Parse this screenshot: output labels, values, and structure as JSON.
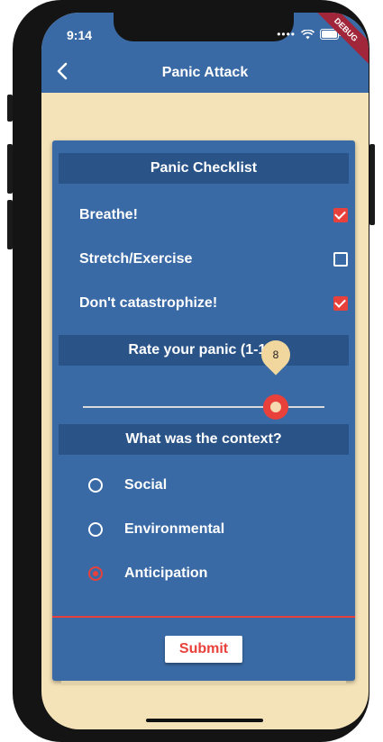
{
  "status_bar": {
    "time": "9:14",
    "debug_label": "DEBUG"
  },
  "app_bar": {
    "title": "Panic Attack"
  },
  "checklist": {
    "header": "Panic Checklist",
    "items": [
      {
        "label": "Breathe!",
        "checked": true
      },
      {
        "label": "Stretch/Exercise",
        "checked": false
      },
      {
        "label": "Don't catastrophize!",
        "checked": true
      }
    ]
  },
  "rating": {
    "header": "Rate your panic (1-10)",
    "value": 8,
    "value_label": "8",
    "min": 1,
    "max": 10
  },
  "context": {
    "header": "What was the context?",
    "options": [
      {
        "label": "Social",
        "selected": false
      },
      {
        "label": "Environmental",
        "selected": false
      },
      {
        "label": "Anticipation",
        "selected": true
      }
    ]
  },
  "submit_label": "Submit",
  "colors": {
    "primary": "#3a6aa5",
    "header_band": "#2a5488",
    "accent": "#e8413b",
    "background": "#f4e2b8"
  }
}
